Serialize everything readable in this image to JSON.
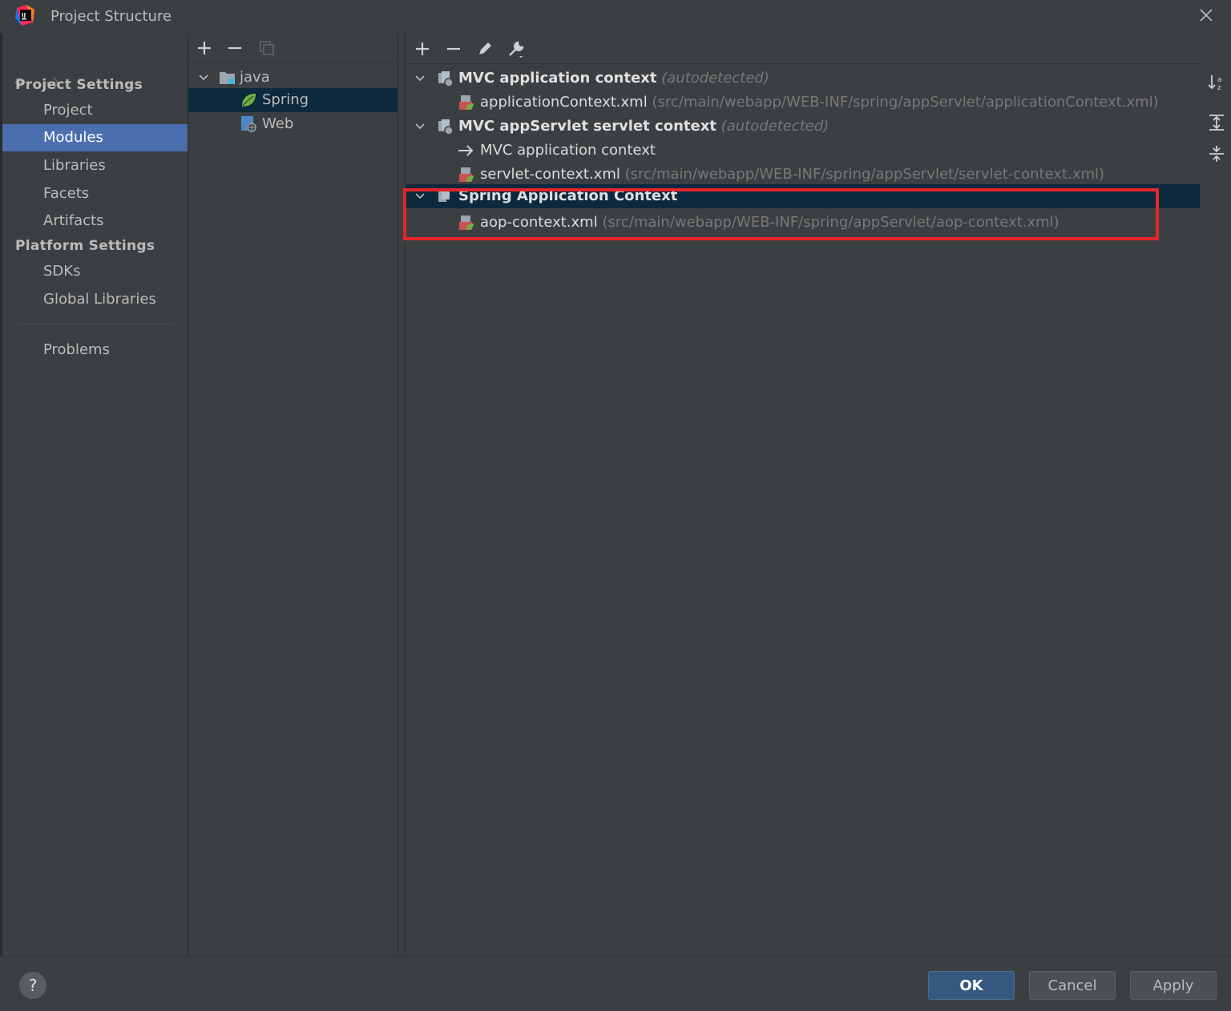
{
  "window": {
    "title": "Project Structure"
  },
  "sidebar": {
    "project_settings_heading": "Project Settings",
    "project_items": [
      "Project",
      "Modules",
      "Libraries",
      "Facets",
      "Artifacts"
    ],
    "platform_settings_heading": "Platform Settings",
    "platform_items": [
      "SDKs",
      "Global Libraries"
    ],
    "problems": "Problems",
    "selected": "Modules"
  },
  "module_tree": {
    "root": "java",
    "children": [
      "Spring",
      "Web"
    ],
    "selected": "Spring"
  },
  "contexts": {
    "c1": {
      "name": "MVC application context",
      "hint": "(autodetected)"
    },
    "c1_file": {
      "name": "applicationContext.xml",
      "path": "(src/main/webapp/WEB-INF/spring/appServlet/applicationContext.xml)"
    },
    "c2": {
      "name": "MVC appServlet servlet context",
      "hint": "(autodetected)"
    },
    "c2_parent": {
      "name": "MVC application context"
    },
    "c2_file": {
      "name": "servlet-context.xml",
      "path": "(src/main/webapp/WEB-INF/spring/appServlet/servlet-context.xml)"
    },
    "c3": {
      "name": "Spring Application Context"
    },
    "c3_file": {
      "name": "aop-context.xml",
      "path": "(src/main/webapp/WEB-INF/spring/appServlet/aop-context.xml)"
    }
  },
  "buttons": {
    "ok": "OK",
    "cancel": "Cancel",
    "apply": "Apply",
    "help": "?"
  },
  "colors": {
    "selection": "#4b6eaf",
    "tree_selection": "#0d293e",
    "highlight": "#e3262b",
    "ok_button": "#365880"
  }
}
